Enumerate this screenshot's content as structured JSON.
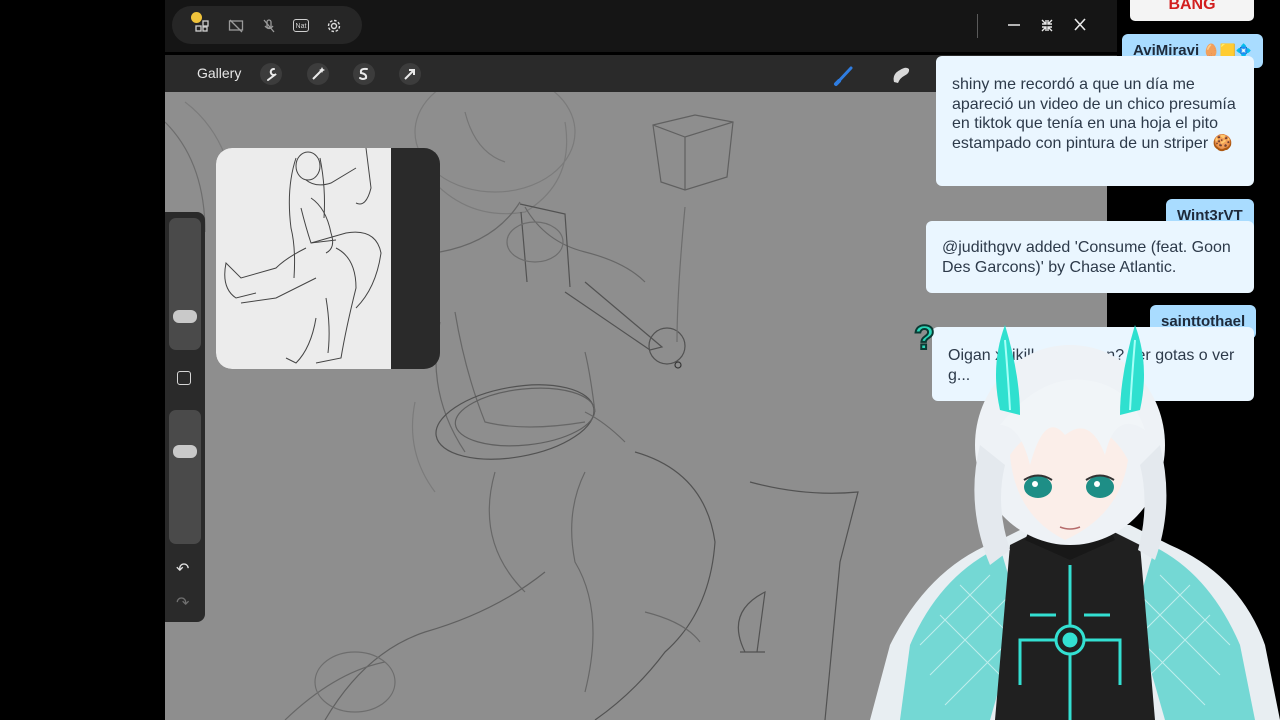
{
  "os_bar": {
    "icons": [
      "layout-icon",
      "screen-off-icon",
      "mute-icon",
      "nat-icon",
      "settings-icon"
    ],
    "nat_label": "Nat",
    "window_controls": [
      "minimize-icon",
      "restore-icon",
      "close-icon"
    ]
  },
  "toolbar": {
    "gallery_label": "Gallery",
    "tools": [
      "wrench-icon",
      "magic-wand-icon",
      "selection-icon",
      "transform-arrow-icon"
    ],
    "right_tools": [
      "brush-icon",
      "smudge-icon"
    ],
    "accent_color": "#2f7de1"
  },
  "sidebar": {
    "controls": [
      "brush-size-slider",
      "modifier-button",
      "opacity-slider",
      "undo-button",
      "redo-button"
    ]
  },
  "chat": {
    "top_partial": "BANG",
    "messages": [
      {
        "user": "AviMiravi",
        "user_emotes": "🥚🟨💠",
        "text": "shiny me recordó a que un día me apareció un video de un chico presumía en tiktok que tenía en una hoja el pito estampado con pintura de un striper",
        "emote": "🍪"
      },
      {
        "user": "Wint3rVT",
        "text": "@judithgvv added 'Consume (feat. Goon Des Garcons)' by Chase Atlantic."
      },
      {
        "user": "sainttothael",
        "text": "Oigan xhikill... prefieren? ver gotas o ver g..."
      }
    ],
    "bubble_color": "#eaf6ff",
    "name_color": "#a9dcff"
  },
  "avatar": {
    "question_mark": "?",
    "accent_color": "#3fe0d0"
  }
}
